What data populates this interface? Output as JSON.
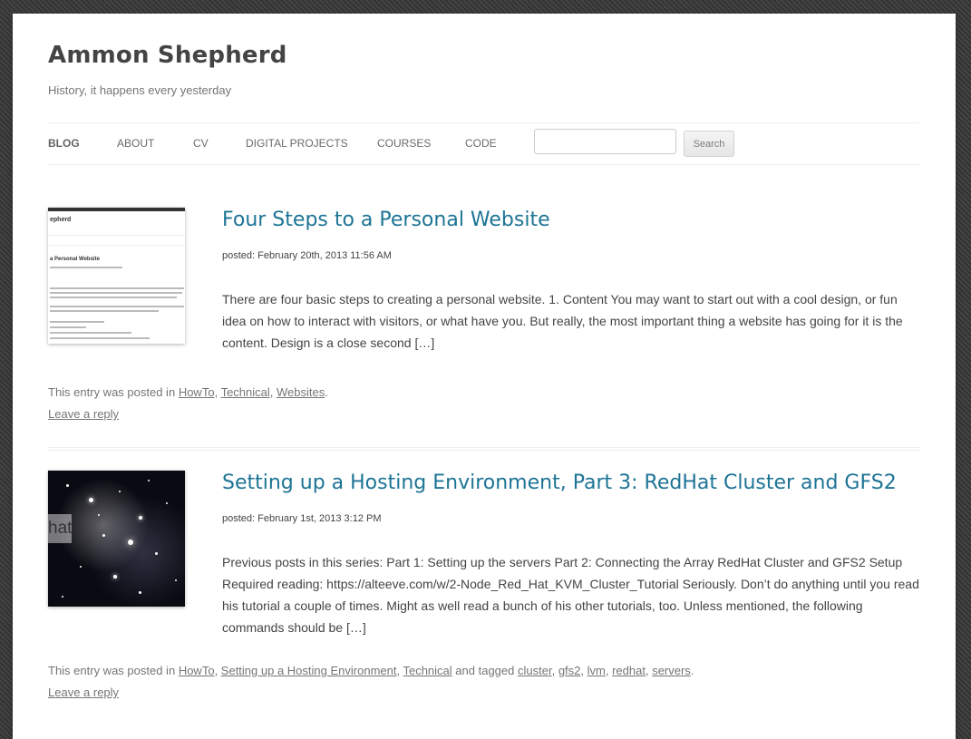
{
  "site": {
    "title": "Ammon Shepherd",
    "description": "History, it happens every yesterday"
  },
  "nav": {
    "items": [
      "BLOG",
      "ABOUT",
      "CV",
      "DIGITAL PROJECTS",
      "COURSES",
      "CODE"
    ],
    "search_button": "Search",
    "search_value": ""
  },
  "posts": [
    {
      "title": "Four Steps to a Personal Website",
      "date": "posted: February 20th, 2013 11:56 AM",
      "excerpt": "There are four basic steps to creating a personal website. 1. Content You may want to start out with a cool design, or fun idea on how to interact with visitors, or what have you. But really, the most important thing a website has going for it is the content. Design is a close second […]",
      "meta_prefix": "This entry was posted in",
      "categories": [
        "HowTo",
        "Technical",
        "Websites"
      ],
      "reply": "Leave a reply",
      "thumb": {
        "title_fragment": "epherd",
        "heading_fragment": "a Personal Website"
      }
    },
    {
      "title": "Setting up a Hosting Environment, Part 3: RedHat Cluster and GFS2",
      "date": "posted: February 1st, 2013 3:12 PM",
      "excerpt": "Previous posts in this series: Part 1: Setting up the servers Part 2: Connecting the Array RedHat Cluster and GFS2 Setup Required reading: https://alteeve.com/w/2-Node_Red_Hat_KVM_Cluster_Tutorial Seriously. Don’t do anything until you read his tutorial a couple of times. Might as well read a bunch of his other tutorials, too. Unless mentioned, the following commands should be […]",
      "meta_prefix": "This entry was posted in",
      "categories": [
        "HowTo",
        "Setting up a Hosting Environment",
        "Technical"
      ],
      "tag_prefix": "and tagged",
      "tags": [
        "cluster",
        "gfs2",
        "lvm",
        "redhat",
        "servers"
      ],
      "reply": "Leave a reply",
      "thumb": {
        "overlay_text": "hat"
      }
    }
  ]
}
